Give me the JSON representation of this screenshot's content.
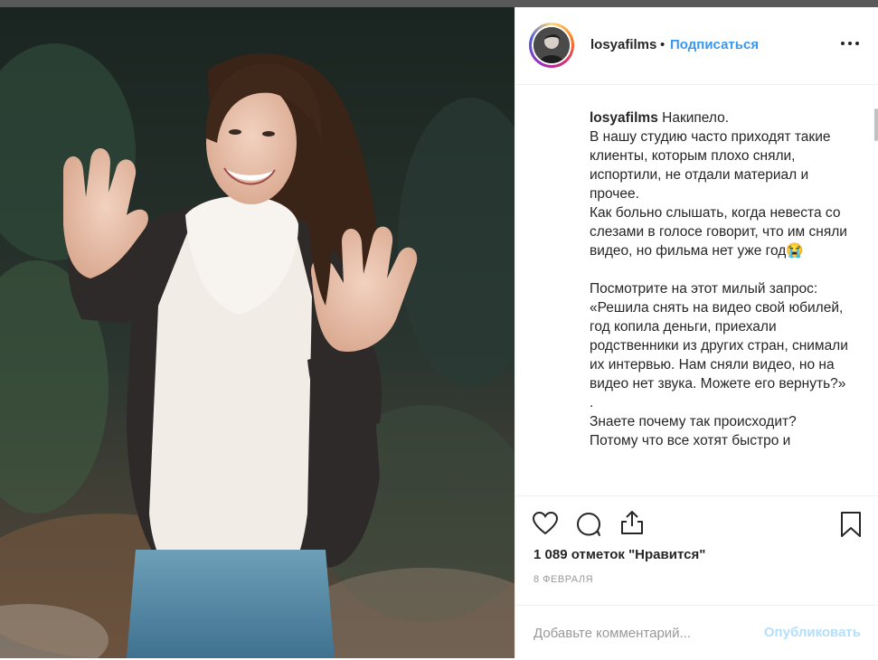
{
  "post": {
    "username": "losyafilms",
    "separator": "•",
    "follow_label": "Подписаться",
    "caption_username": "losyafilms",
    "caption_text": "Накипело.\nВ нашу студию часто приходят такие клиенты, которым плохо сняли, испортили, не отдали материал и прочее.\nКак больно слышать, когда невеста со слезами в голосе говорит, что им сняли видео, но фильма нет уже год😭\n\nПосмотрите на этот милый запрос:\n«Решила снять на видео свой юбилей, год копила деньги, приехали родственники из других стран, снимали их интервью. Нам сняли видео, но на видео нет звука. Можете его вернуть?»\n.\nЗнаете почему так происходит?\nПотому что все хотят быстро и",
    "likes_text": "1 089 отметок \"Нравится\"",
    "date_text": "8 ФЕВРАЛЯ"
  },
  "comment": {
    "placeholder": "Добавьте комментарий...",
    "publish_label": "Опубликовать"
  },
  "icons": {
    "like": "heart-icon",
    "comment": "comment-icon",
    "share": "share-icon",
    "save": "bookmark-icon",
    "more": "more-dots-icon"
  },
  "colors": {
    "accent": "#3897f0",
    "publish_disabled": "#b2dffc",
    "muted": "#999999",
    "text": "#262626"
  }
}
